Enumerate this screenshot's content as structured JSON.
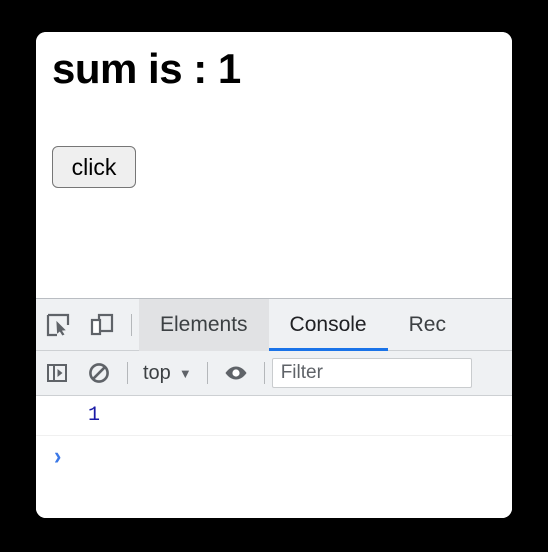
{
  "page": {
    "heading": "sum is : 1",
    "button_label": "click"
  },
  "devtools": {
    "inspect_icon": "inspect-element-cursor-icon",
    "device_icon": "device-toolbar-icon",
    "tabs": [
      {
        "label": "Elements",
        "active": false,
        "hovered": true
      },
      {
        "label": "Console",
        "active": true,
        "hovered": false
      },
      {
        "label": "Rec",
        "active": false,
        "hovered": false
      }
    ],
    "console_toolbar": {
      "sidebar_icon": "console-sidebar-toggle-icon",
      "clear_icon": "clear-console-icon",
      "context_label": "top",
      "context_caret": "▼",
      "eye_icon": "live-expression-eye-icon",
      "filter_placeholder": "Filter"
    },
    "console_messages": [
      {
        "value": "1",
        "type": "number"
      }
    ],
    "prompt_chevron": "›"
  },
  "colors": {
    "page_background": "#000000",
    "card_background": "#ffffff",
    "toolbar_background": "#eff1f3",
    "tab_hover_background": "#e1e2e4",
    "active_tab_underline": "#1a73e8",
    "console_number": "#1a1aa6",
    "prompt_chevron": "#3b78e7",
    "button_face": "#efefef",
    "button_border": "#767676"
  }
}
